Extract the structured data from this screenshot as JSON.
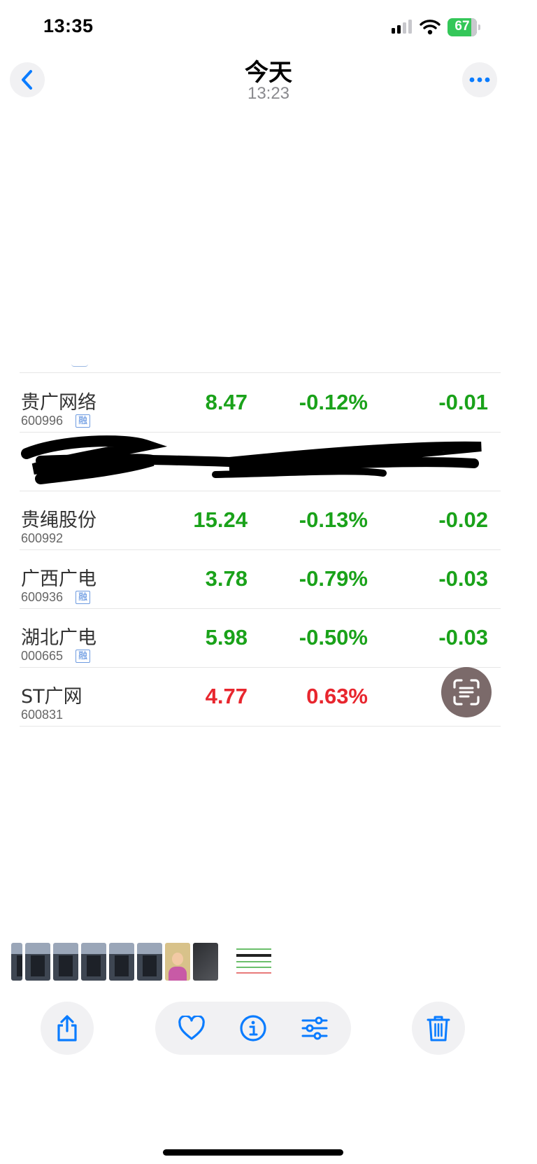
{
  "status_bar": {
    "time": "13:35",
    "battery_level": "67",
    "icons": [
      "cellular-signal-icon",
      "wifi-icon",
      "battery-charging-icon"
    ]
  },
  "nav": {
    "title": "今天",
    "subtitle": "13:23",
    "back_icon": "chevron-left-icon",
    "more_icon": "ellipsis-icon"
  },
  "stocks": {
    "rows": [
      {
        "name": "贵广网络",
        "code": "600996",
        "badge": "融",
        "price": "8.47",
        "pct": "-0.12%",
        "chg": "-0.01",
        "trend": "down"
      },
      {
        "name": "贵绳股份",
        "code": "600992",
        "badge": "",
        "price": "15.24",
        "pct": "-0.13%",
        "chg": "-0.02",
        "trend": "down"
      },
      {
        "name": "广西广电",
        "code": "600936",
        "badge": "融",
        "price": "3.78",
        "pct": "-0.79%",
        "chg": "-0.03",
        "trend": "down"
      },
      {
        "name": "湖北广电",
        "code": "000665",
        "badge": "融",
        "price": "5.98",
        "pct": "-0.50%",
        "chg": "-0.03",
        "trend": "down"
      },
      {
        "name": "ST广网",
        "code": "600831",
        "badge": "",
        "price": "4.77",
        "pct": "0.63%",
        "chg": "",
        "trend": "up"
      }
    ]
  },
  "colors": {
    "down": "#1aa21a",
    "up": "#e8262e",
    "accent": "#0a7cff"
  },
  "floating": {
    "livetext_icon": "live-text-scan-icon"
  },
  "toolbar": {
    "share_icon": "share-icon",
    "favorite_icon": "heart-icon",
    "info_icon": "info-icon",
    "adjust_icon": "sliders-icon",
    "delete_icon": "trash-icon"
  }
}
